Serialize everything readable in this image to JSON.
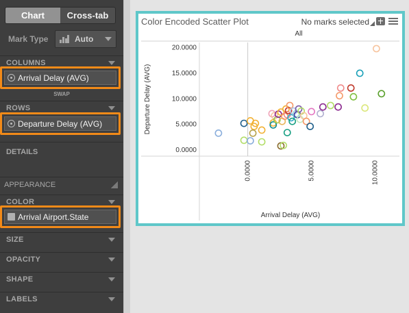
{
  "panel": {
    "tabs": [
      {
        "label": "Chart",
        "active": true
      },
      {
        "label": "Cross-tab",
        "active": false
      }
    ],
    "mark_type": {
      "label": "Mark Type",
      "value": "Auto",
      "icon": "area-chart-icon"
    },
    "sections": {
      "columns": "COLUMNS",
      "rows": "ROWS",
      "details": "DETAILS",
      "appearance": "APPEARANCE",
      "color": "COLOR",
      "size": "SIZE",
      "opacity": "OPACITY",
      "shape": "SHAPE",
      "labels": "LABELS"
    },
    "columns_field": "Arrival Delay (AVG)",
    "rows_field": "Departure Delay (AVG)",
    "color_field": "Arrival Airport.State",
    "swap_label": "SWAP",
    "highlight_color": "#f28a18"
  },
  "chart": {
    "title": "Color Encoded Scatter Plot",
    "status": "No marks selected",
    "accent": "#5fc7c9"
  },
  "chart_data": {
    "type": "scatter",
    "facet_label": "All",
    "xlabel": "Arrival Delay (AVG)",
    "ylabel": "Departure Delay (AVG)",
    "xlim": [
      -3.8,
      11.8
    ],
    "ylim": [
      -1.2,
      21.0
    ],
    "xticks": [
      "0.0000",
      "5.0000",
      "10.0000"
    ],
    "xtick_values": [
      0,
      5,
      10
    ],
    "yticks": [
      "0.0000",
      "5.0000",
      "10.0000",
      "15.0000",
      "20.0000"
    ],
    "ytick_values": [
      0,
      5,
      10,
      15,
      20
    ],
    "grid": false,
    "marker": "hollow-circle",
    "points": [
      {
        "x": -2.3,
        "y": 3.3,
        "color": "#8aaedc"
      },
      {
        "x": -0.3,
        "y": 5.2,
        "color": "#1f5f8b"
      },
      {
        "x": 0.2,
        "y": 5.7,
        "color": "#f2b134"
      },
      {
        "x": 0.5,
        "y": 4.6,
        "color": "#f2b134"
      },
      {
        "x": 0.6,
        "y": 5.2,
        "color": "#f2b134"
      },
      {
        "x": 0.4,
        "y": 3.3,
        "color": "#b6a24a"
      },
      {
        "x": -0.3,
        "y": 1.9,
        "color": "#b3de69"
      },
      {
        "x": 0.2,
        "y": 1.8,
        "color": "#8aaedc"
      },
      {
        "x": 1.1,
        "y": 3.9,
        "color": "#f2b134"
      },
      {
        "x": 1.1,
        "y": 1.6,
        "color": "#b3de69"
      },
      {
        "x": 1.9,
        "y": 7.1,
        "color": "#f0a4b8"
      },
      {
        "x": 2.0,
        "y": 5.3,
        "color": "#f2b134"
      },
      {
        "x": 2.0,
        "y": 4.9,
        "color": "#0f8a8f"
      },
      {
        "x": 2.1,
        "y": 6.7,
        "color": "#f7c5a0"
      },
      {
        "x": 2.3,
        "y": 5.9,
        "color": "#9bcb4f"
      },
      {
        "x": 2.4,
        "y": 7.0,
        "color": "#8c2b8f"
      },
      {
        "x": 2.6,
        "y": 7.4,
        "color": "#f2b134"
      },
      {
        "x": 2.7,
        "y": 5.6,
        "color": "#e8b55a"
      },
      {
        "x": 2.9,
        "y": 6.6,
        "color": "#f59a6a"
      },
      {
        "x": 3.0,
        "y": 8.0,
        "color": "#f2b134"
      },
      {
        "x": 3.1,
        "y": 6.9,
        "color": "#f08a8a"
      },
      {
        "x": 3.2,
        "y": 7.7,
        "color": "#c0392b"
      },
      {
        "x": 3.3,
        "y": 8.7,
        "color": "#f59a6a"
      },
      {
        "x": 3.4,
        "y": 6.3,
        "color": "#2ea8c8"
      },
      {
        "x": 3.5,
        "y": 5.6,
        "color": "#1aa084"
      },
      {
        "x": 3.6,
        "y": 7.6,
        "color": "#a9c4e8"
      },
      {
        "x": 3.8,
        "y": 7.1,
        "color": "#9bd5d9"
      },
      {
        "x": 3.9,
        "y": 6.9,
        "color": "#3f3f9f"
      },
      {
        "x": 4.0,
        "y": 8.0,
        "color": "#7b5ba6"
      },
      {
        "x": 4.1,
        "y": 6.0,
        "color": "#c7e9c0"
      },
      {
        "x": 4.2,
        "y": 7.6,
        "color": "#b3de69"
      },
      {
        "x": 3.1,
        "y": 3.4,
        "color": "#1aa084"
      },
      {
        "x": 2.6,
        "y": 0.8,
        "color": "#8c6d31"
      },
      {
        "x": 2.8,
        "y": 0.9,
        "color": "#b3de69"
      },
      {
        "x": 4.4,
        "y": 6.7,
        "color": "#f7c5a0"
      },
      {
        "x": 4.6,
        "y": 5.6,
        "color": "#f59a6a"
      },
      {
        "x": 4.9,
        "y": 4.6,
        "color": "#1f5f8b"
      },
      {
        "x": 5.0,
        "y": 7.5,
        "color": "#e377c2"
      },
      {
        "x": 5.7,
        "y": 7.1,
        "color": "#b0b0d0"
      },
      {
        "x": 5.9,
        "y": 8.4,
        "color": "#8c2b8f"
      },
      {
        "x": 6.5,
        "y": 8.7,
        "color": "#b3de69"
      },
      {
        "x": 7.1,
        "y": 8.4,
        "color": "#8c2b8f"
      },
      {
        "x": 7.3,
        "y": 12.1,
        "color": "#f08a8a"
      },
      {
        "x": 7.2,
        "y": 10.6,
        "color": "#f59a6a"
      },
      {
        "x": 8.1,
        "y": 12.1,
        "color": "#c0392b"
      },
      {
        "x": 8.3,
        "y": 10.4,
        "color": "#7fbf3f"
      },
      {
        "x": 8.8,
        "y": 15.0,
        "color": "#1aa0b8"
      },
      {
        "x": 9.2,
        "y": 8.2,
        "color": "#dbe77a"
      },
      {
        "x": 10.1,
        "y": 19.8,
        "color": "#f7c5a0"
      },
      {
        "x": 10.5,
        "y": 11.0,
        "color": "#5aa02c"
      }
    ]
  }
}
